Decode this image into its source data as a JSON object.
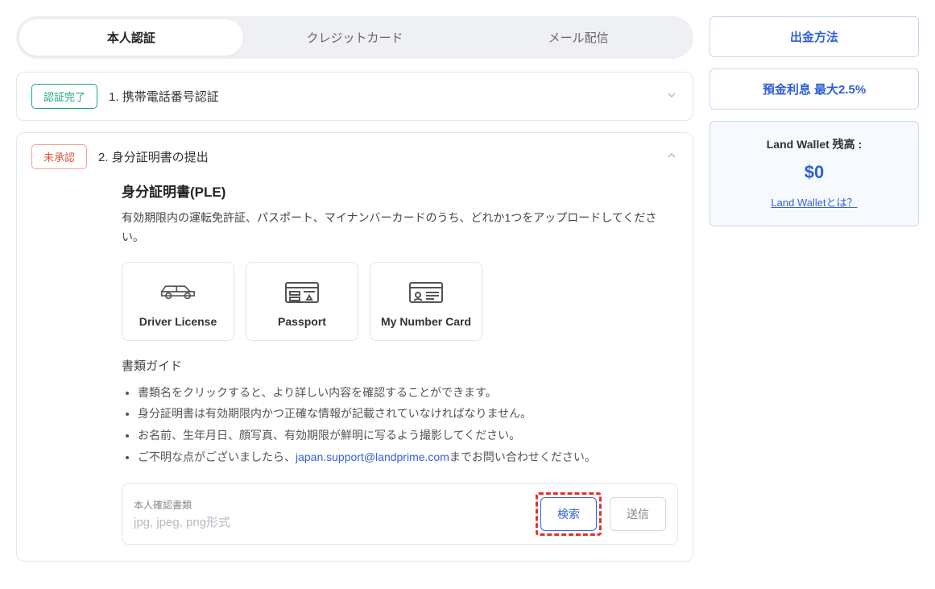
{
  "tabs": {
    "items": [
      "本人認証",
      "クレジットカード",
      "メール配信"
    ],
    "active_index": 0
  },
  "accordion": {
    "step1": {
      "badge": "認証完了",
      "title": "1. 携帯電話番号認証",
      "expanded": false
    },
    "step2": {
      "badge": "未承認",
      "title": "2. 身分証明書の提出",
      "expanded": true,
      "content": {
        "section_title": "身分証明書(PLE)",
        "section_desc": "有効期限内の運転免許証、パスポート、マイナンバーカードのうち、どれか1つをアップロードしてください。",
        "doc_options": [
          {
            "label": "Driver License",
            "icon": "car"
          },
          {
            "label": "Passport",
            "icon": "passport"
          },
          {
            "label": "My Number Card",
            "icon": "idcard"
          }
        ],
        "guide_title": "書類ガイド",
        "guide_items": [
          "書類名をクリックすると、より詳しい内容を確認することができます。",
          "身分証明書は有効期限内かつ正確な情報が記載されていなければなりません。",
          "お名前、生年月日、顔写真、有効期限が鮮明に写るよう撮影してください。"
        ],
        "guide_contact_prefix": "ご不明な点がございましたら、",
        "guide_contact_email": "japan.support@landprime.com",
        "guide_contact_suffix": "までお問い合わせください。",
        "upload": {
          "label": "本人確認書類",
          "format": "jpg, jpeg, png形式",
          "browse_btn": "検索",
          "submit_btn": "送信"
        }
      }
    }
  },
  "sidebar": {
    "buttons": [
      "出金方法",
      "預金利息 最大2.5%"
    ],
    "wallet": {
      "label": "Land Wallet 残高 :",
      "balance": "$0",
      "link": "Land Walletとは？"
    }
  }
}
